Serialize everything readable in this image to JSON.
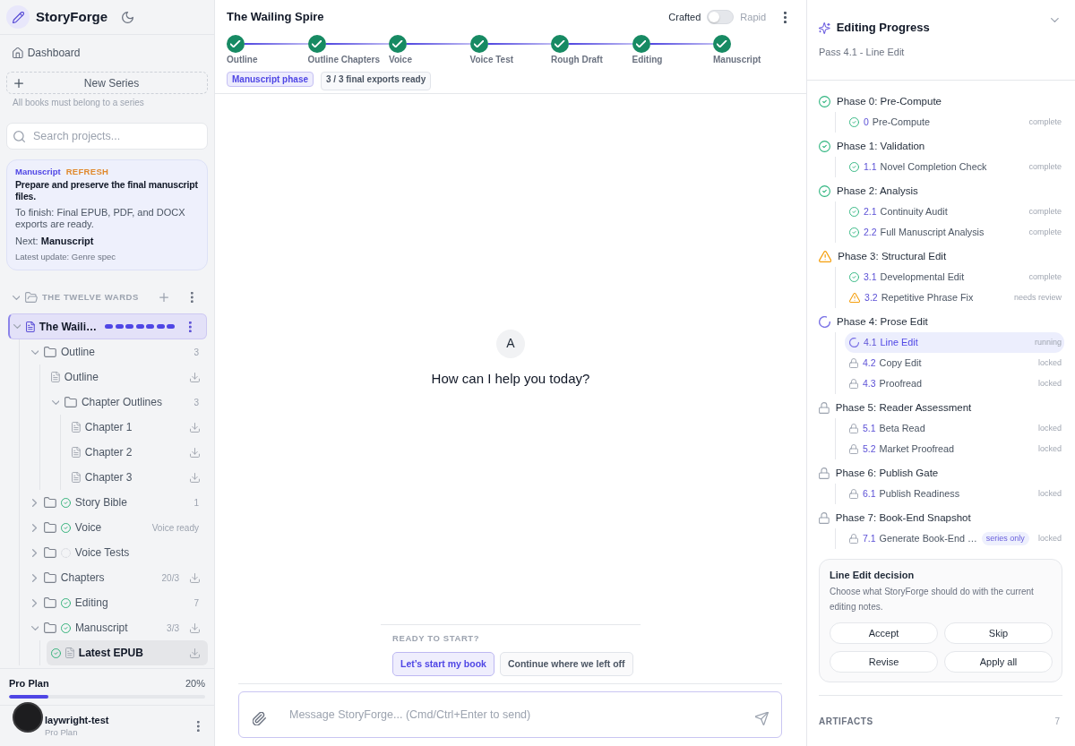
{
  "sidebar": {
    "brand": "StoryForge",
    "dashboard_link": "Dashboard",
    "new_series_button": "New Series",
    "new_series_hint": "All books must belong to a series",
    "search": {
      "placeholder": "Search projects..."
    },
    "status_card": {
      "phase": "Manuscript",
      "tag": "REFRESH",
      "title": "Prepare and preserve the final manuscript files.",
      "requirement": "To finish: Final EPUB, PDF, and DOCX exports are ready.",
      "next": "Next: **Manuscript**",
      "update": "Latest update: Genre spec"
    },
    "series": {
      "title": "THE TWELVE WARDS",
      "expanded": true,
      "books": [
        {
          "title": "The Waili…",
          "selected": true,
          "expanded": true,
          "stages": [
            {
              "complete": true
            },
            {
              "complete": true
            },
            {
              "complete": true
            },
            {
              "complete": true
            },
            {
              "complete": true
            },
            {
              "complete": true
            },
            {
              "complete": true
            }
          ],
          "tree": [
            {
              "kind": "folder",
              "label": "Outline",
              "complete": false,
              "pending": false,
              "meta": "3",
              "download": false,
              "expanded": true,
              "selected": false,
              "children": [
                {
                  "kind": "file",
                  "label": "Outline",
                  "complete": false,
                  "pending": false,
                  "download": true,
                  "selected": false
                },
                {
                  "kind": "folder",
                  "label": "Chapter Outlines",
                  "complete": false,
                  "pending": false,
                  "meta": "3",
                  "download": false,
                  "expanded": true,
                  "selected": false,
                  "children": [
                    {
                      "kind": "file",
                      "label": "Chapter 1",
                      "complete": false,
                      "pending": false,
                      "download": true,
                      "selected": false
                    },
                    {
                      "kind": "file",
                      "label": "Chapter 2",
                      "complete": false,
                      "pending": false,
                      "download": true,
                      "selected": false
                    },
                    {
                      "kind": "file",
                      "label": "Chapter 3",
                      "complete": false,
                      "pending": false,
                      "download": true,
                      "selected": false
                    }
                  ]
                }
              ]
            },
            {
              "kind": "folder",
              "label": "Story Bible",
              "complete": true,
              "pending": false,
              "meta": "1",
              "download": false,
              "expanded": false,
              "selected": false
            },
            {
              "kind": "folder",
              "label": "Voice",
              "complete": true,
              "pending": false,
              "meta": "Voice ready",
              "download": false,
              "expanded": false,
              "selected": false
            },
            {
              "kind": "folder",
              "label": "Voice Tests",
              "complete": false,
              "pending": true,
              "download": false,
              "expanded": false,
              "selected": false
            },
            {
              "kind": "folder",
              "label": "Chapters",
              "complete": false,
              "pending": false,
              "meta": "20/3",
              "download": true,
              "expanded": false,
              "selected": false
            },
            {
              "kind": "folder",
              "label": "Editing",
              "complete": true,
              "pending": false,
              "meta": "7",
              "download": false,
              "expanded": false,
              "selected": false
            },
            {
              "kind": "folder",
              "label": "Manuscript",
              "complete": true,
              "pending": false,
              "meta": "3/3",
              "download": true,
              "expanded": true,
              "selected": false,
              "children": [
                {
                  "kind": "file",
                  "label": "Latest EPUB",
                  "complete": true,
                  "pending": false,
                  "download": true,
                  "selected": true
                }
              ]
            }
          ]
        }
      ]
    },
    "plan": {
      "name": "Pro Plan",
      "percent": "20%",
      "level": 0.2
    },
    "user": {
      "name": "laywright-test",
      "plan": "Pro Plan"
    }
  },
  "header": {
    "title": "The Wailing Spire",
    "mode": {
      "left_label": "Crafted",
      "right_label": "Rapid",
      "on": false
    },
    "steps": [
      {
        "label": "Outline",
        "complete": true
      },
      {
        "label": "Outline Chapters",
        "complete": true
      },
      {
        "label": "Voice",
        "complete": true
      },
      {
        "label": "Voice Test",
        "complete": true
      },
      {
        "label": "Rough Draft",
        "complete": true
      },
      {
        "label": "Editing",
        "complete": true
      },
      {
        "label": "Manuscript",
        "complete": true
      }
    ],
    "badges": [
      {
        "text": "Manuscript phase",
        "kind": "phase"
      },
      {
        "text": "3 / 3 final exports ready",
        "kind": "info"
      }
    ]
  },
  "chat": {
    "avatar": "A",
    "greeting": "How can I help you today?",
    "prompt_heading": "READY TO START?",
    "suggestions": [
      {
        "label": "Let’s start my book",
        "kind": "primary"
      },
      {
        "label": "Continue where we left off",
        "kind": "secondary"
      }
    ],
    "input": {
      "placeholder": "Message StoryForge... (Cmd/Ctrl+Enter to send)"
    }
  },
  "editing_panel": {
    "title": "Editing Progress",
    "subtitle": "Pass 4.1 - Line Edit",
    "phases": [
      {
        "title": "Phase 0: Pre-Compute",
        "kind": "complete",
        "passes": [
          {
            "number": "0",
            "name": "Pre-Compute",
            "kind": "complete",
            "status_text": "complete",
            "selected": false
          }
        ]
      },
      {
        "title": "Phase 1: Validation",
        "kind": "complete",
        "passes": [
          {
            "number": "1.1",
            "name": "Novel Completion Check",
            "kind": "complete",
            "status_text": "complete",
            "selected": false
          }
        ]
      },
      {
        "title": "Phase 2: Analysis",
        "kind": "complete",
        "passes": [
          {
            "number": "2.1",
            "name": "Continuity Audit",
            "kind": "complete",
            "status_text": "complete",
            "selected": false
          },
          {
            "number": "2.2",
            "name": "Full Manuscript Analysis",
            "kind": "complete",
            "status_text": "complete",
            "selected": false
          }
        ]
      },
      {
        "title": "Phase 3: Structural Edit",
        "kind": "warning",
        "passes": [
          {
            "number": "3.1",
            "name": "Developmental Edit",
            "kind": "complete",
            "status_text": "complete",
            "selected": false
          },
          {
            "number": "3.2",
            "name": "Repetitive Phrase Fix",
            "kind": "warning",
            "status_text": "needs review",
            "selected": false
          }
        ]
      },
      {
        "title": "Phase 4: Prose Edit",
        "kind": "running",
        "passes": [
          {
            "number": "4.1",
            "name": "Line Edit",
            "kind": "running",
            "status_text": "running",
            "selected": true
          },
          {
            "number": "4.2",
            "name": "Copy Edit",
            "kind": "locked",
            "status_text": "locked",
            "selected": false
          },
          {
            "number": "4.3",
            "name": "Proofread",
            "kind": "locked",
            "status_text": "locked",
            "selected": false
          }
        ]
      },
      {
        "title": "Phase 5: Reader Assessment",
        "kind": "locked",
        "passes": [
          {
            "number": "5.1",
            "name": "Beta Read",
            "kind": "locked",
            "status_text": "locked",
            "selected": false
          },
          {
            "number": "5.2",
            "name": "Market Proofread",
            "kind": "locked",
            "status_text": "locked",
            "selected": false
          }
        ]
      },
      {
        "title": "Phase 6: Publish Gate",
        "kind": "locked",
        "passes": [
          {
            "number": "6.1",
            "name": "Publish Readiness",
            "kind": "locked",
            "status_text": "locked",
            "selected": false
          }
        ]
      },
      {
        "title": "Phase 7: Book-End Snapshot",
        "kind": "locked",
        "passes": [
          {
            "number": "7.1",
            "name": "Generate Book-End …",
            "tag": "series only",
            "kind": "locked",
            "status_text": "locked",
            "selected": false
          }
        ]
      }
    ],
    "decision": {
      "title": "Line Edit decision",
      "text": "Choose what StoryForge should do with the current editing notes.",
      "actions": [
        "Accept",
        "Skip",
        "Revise",
        "Apply all"
      ]
    },
    "artifacts": {
      "label": "ARTIFACTS",
      "count": "7"
    }
  }
}
